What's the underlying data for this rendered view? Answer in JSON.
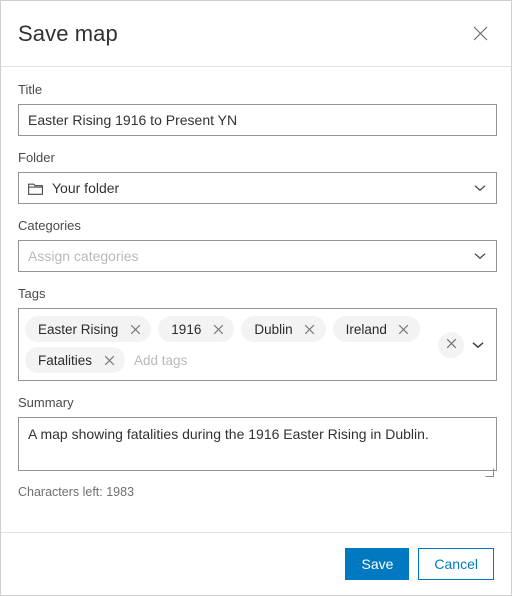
{
  "dialog": {
    "title": "Save map",
    "close_icon": "close-icon"
  },
  "fields": {
    "title": {
      "label": "Title",
      "value": "Easter Rising 1916 to Present YN",
      "placeholder": "Title"
    },
    "folder": {
      "label": "Folder",
      "value": "Your folder",
      "icon": "folder-icon",
      "chevron": "chevron-down-icon"
    },
    "categories": {
      "label": "Categories",
      "value": "",
      "placeholder": "Assign categories",
      "chevron": "chevron-down-icon"
    },
    "tags": {
      "label": "Tags",
      "chips": [
        "Easter Rising",
        "1916",
        "Dublin",
        "Ireland",
        "Fatalities"
      ],
      "placeholder": "Add tags",
      "value": "",
      "clear_icon": "close-icon",
      "chevron": "chevron-down-icon"
    },
    "summary": {
      "label": "Summary",
      "value": "A map showing fatalities during the 1916 Easter Rising in Dublin.",
      "placeholder": "Summary",
      "characters_left": "Characters left: 1983"
    }
  },
  "footer": {
    "save_label": "Save",
    "cancel_label": "Cancel"
  },
  "colors": {
    "accent": "#0079c1",
    "border": "#949494",
    "divider": "#e0e0e0",
    "chip_bg": "#f3f3f3",
    "placeholder": "#b9b9b9"
  }
}
